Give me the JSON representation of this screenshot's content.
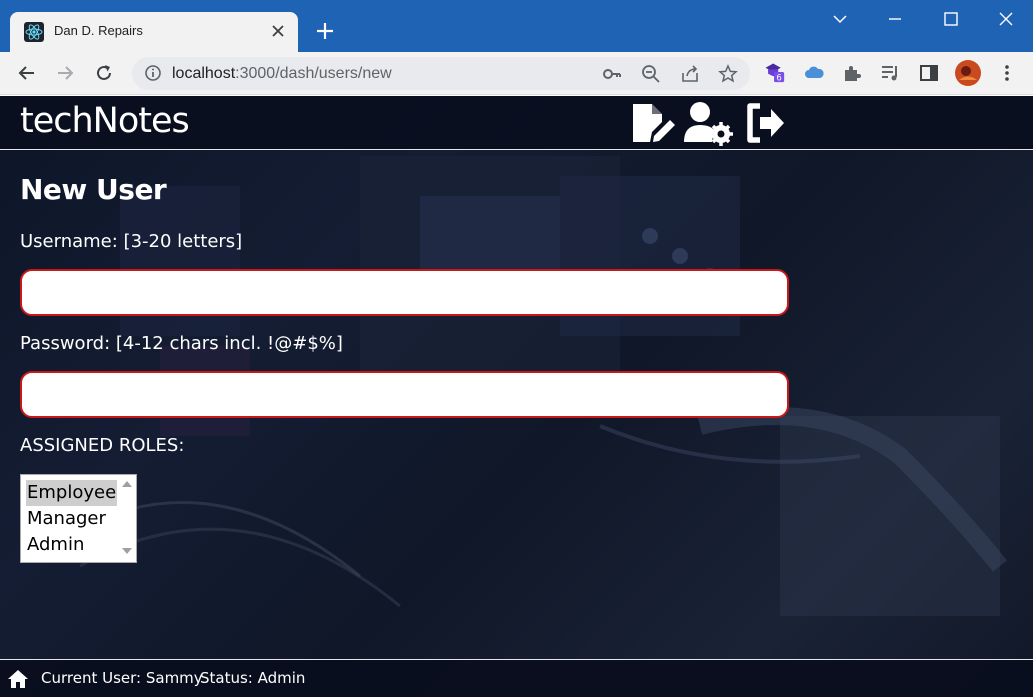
{
  "browser": {
    "tab_title": "Dan D. Repairs",
    "url_host": "localhost",
    "url_rest": ":3000/dash/users/new",
    "extension_badge": "6"
  },
  "app": {
    "brand": "techNotes",
    "form": {
      "title": "New User",
      "username_label": "Username: [3-20 letters]",
      "username_value": "",
      "password_label": "Password: [4-12 chars incl. !@#$%]",
      "password_value": "",
      "roles_label": "ASSIGNED ROLES:",
      "roles": [
        "Employee",
        "Manager",
        "Admin"
      ],
      "selected_role": "Employee"
    },
    "footer": {
      "current_user": "Current User: Sammy",
      "status": "Status: Admin"
    }
  },
  "colors": {
    "browser_frame": "#1f63b5",
    "input_border": "#c81818",
    "app_bg": "#0d1527"
  }
}
